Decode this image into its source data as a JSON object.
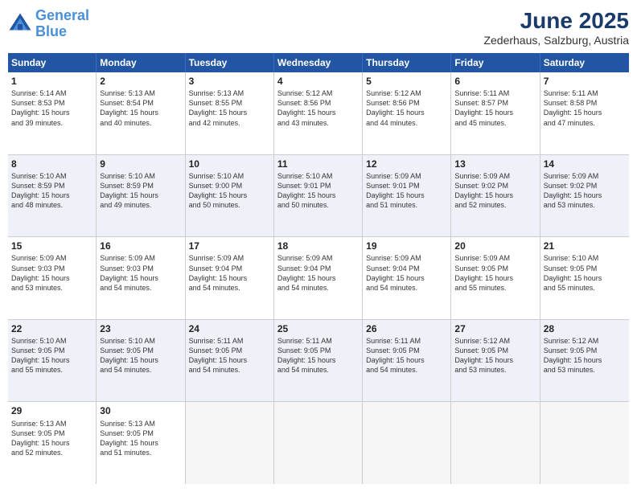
{
  "logo": {
    "text1": "General",
    "text2": "Blue"
  },
  "title": "June 2025",
  "subtitle": "Zederhaus, Salzburg, Austria",
  "header_days": [
    "Sunday",
    "Monday",
    "Tuesday",
    "Wednesday",
    "Thursday",
    "Friday",
    "Saturday"
  ],
  "rows": [
    {
      "cells": [
        {
          "day": "1",
          "lines": [
            "Sunrise: 5:14 AM",
            "Sunset: 8:53 PM",
            "Daylight: 15 hours",
            "and 39 minutes."
          ]
        },
        {
          "day": "2",
          "lines": [
            "Sunrise: 5:13 AM",
            "Sunset: 8:54 PM",
            "Daylight: 15 hours",
            "and 40 minutes."
          ]
        },
        {
          "day": "3",
          "lines": [
            "Sunrise: 5:13 AM",
            "Sunset: 8:55 PM",
            "Daylight: 15 hours",
            "and 42 minutes."
          ]
        },
        {
          "day": "4",
          "lines": [
            "Sunrise: 5:12 AM",
            "Sunset: 8:56 PM",
            "Daylight: 15 hours",
            "and 43 minutes."
          ]
        },
        {
          "day": "5",
          "lines": [
            "Sunrise: 5:12 AM",
            "Sunset: 8:56 PM",
            "Daylight: 15 hours",
            "and 44 minutes."
          ]
        },
        {
          "day": "6",
          "lines": [
            "Sunrise: 5:11 AM",
            "Sunset: 8:57 PM",
            "Daylight: 15 hours",
            "and 45 minutes."
          ]
        },
        {
          "day": "7",
          "lines": [
            "Sunrise: 5:11 AM",
            "Sunset: 8:58 PM",
            "Daylight: 15 hours",
            "and 47 minutes."
          ]
        }
      ]
    },
    {
      "cells": [
        {
          "day": "8",
          "lines": [
            "Sunrise: 5:10 AM",
            "Sunset: 8:59 PM",
            "Daylight: 15 hours",
            "and 48 minutes."
          ]
        },
        {
          "day": "9",
          "lines": [
            "Sunrise: 5:10 AM",
            "Sunset: 8:59 PM",
            "Daylight: 15 hours",
            "and 49 minutes."
          ]
        },
        {
          "day": "10",
          "lines": [
            "Sunrise: 5:10 AM",
            "Sunset: 9:00 PM",
            "Daylight: 15 hours",
            "and 50 minutes."
          ]
        },
        {
          "day": "11",
          "lines": [
            "Sunrise: 5:10 AM",
            "Sunset: 9:01 PM",
            "Daylight: 15 hours",
            "and 50 minutes."
          ]
        },
        {
          "day": "12",
          "lines": [
            "Sunrise: 5:09 AM",
            "Sunset: 9:01 PM",
            "Daylight: 15 hours",
            "and 51 minutes."
          ]
        },
        {
          "day": "13",
          "lines": [
            "Sunrise: 5:09 AM",
            "Sunset: 9:02 PM",
            "Daylight: 15 hours",
            "and 52 minutes."
          ]
        },
        {
          "day": "14",
          "lines": [
            "Sunrise: 5:09 AM",
            "Sunset: 9:02 PM",
            "Daylight: 15 hours",
            "and 53 minutes."
          ]
        }
      ]
    },
    {
      "cells": [
        {
          "day": "15",
          "lines": [
            "Sunrise: 5:09 AM",
            "Sunset: 9:03 PM",
            "Daylight: 15 hours",
            "and 53 minutes."
          ]
        },
        {
          "day": "16",
          "lines": [
            "Sunrise: 5:09 AM",
            "Sunset: 9:03 PM",
            "Daylight: 15 hours",
            "and 54 minutes."
          ]
        },
        {
          "day": "17",
          "lines": [
            "Sunrise: 5:09 AM",
            "Sunset: 9:04 PM",
            "Daylight: 15 hours",
            "and 54 minutes."
          ]
        },
        {
          "day": "18",
          "lines": [
            "Sunrise: 5:09 AM",
            "Sunset: 9:04 PM",
            "Daylight: 15 hours",
            "and 54 minutes."
          ]
        },
        {
          "day": "19",
          "lines": [
            "Sunrise: 5:09 AM",
            "Sunset: 9:04 PM",
            "Daylight: 15 hours",
            "and 54 minutes."
          ]
        },
        {
          "day": "20",
          "lines": [
            "Sunrise: 5:09 AM",
            "Sunset: 9:05 PM",
            "Daylight: 15 hours",
            "and 55 minutes."
          ]
        },
        {
          "day": "21",
          "lines": [
            "Sunrise: 5:10 AM",
            "Sunset: 9:05 PM",
            "Daylight: 15 hours",
            "and 55 minutes."
          ]
        }
      ]
    },
    {
      "cells": [
        {
          "day": "22",
          "lines": [
            "Sunrise: 5:10 AM",
            "Sunset: 9:05 PM",
            "Daylight: 15 hours",
            "and 55 minutes."
          ]
        },
        {
          "day": "23",
          "lines": [
            "Sunrise: 5:10 AM",
            "Sunset: 9:05 PM",
            "Daylight: 15 hours",
            "and 54 minutes."
          ]
        },
        {
          "day": "24",
          "lines": [
            "Sunrise: 5:11 AM",
            "Sunset: 9:05 PM",
            "Daylight: 15 hours",
            "and 54 minutes."
          ]
        },
        {
          "day": "25",
          "lines": [
            "Sunrise: 5:11 AM",
            "Sunset: 9:05 PM",
            "Daylight: 15 hours",
            "and 54 minutes."
          ]
        },
        {
          "day": "26",
          "lines": [
            "Sunrise: 5:11 AM",
            "Sunset: 9:05 PM",
            "Daylight: 15 hours",
            "and 54 minutes."
          ]
        },
        {
          "day": "27",
          "lines": [
            "Sunrise: 5:12 AM",
            "Sunset: 9:05 PM",
            "Daylight: 15 hours",
            "and 53 minutes."
          ]
        },
        {
          "day": "28",
          "lines": [
            "Sunrise: 5:12 AM",
            "Sunset: 9:05 PM",
            "Daylight: 15 hours",
            "and 53 minutes."
          ]
        }
      ]
    },
    {
      "cells": [
        {
          "day": "29",
          "lines": [
            "Sunrise: 5:13 AM",
            "Sunset: 9:05 PM",
            "Daylight: 15 hours",
            "and 52 minutes."
          ]
        },
        {
          "day": "30",
          "lines": [
            "Sunrise: 5:13 AM",
            "Sunset: 9:05 PM",
            "Daylight: 15 hours",
            "and 51 minutes."
          ]
        },
        {
          "day": "",
          "lines": []
        },
        {
          "day": "",
          "lines": []
        },
        {
          "day": "",
          "lines": []
        },
        {
          "day": "",
          "lines": []
        },
        {
          "day": "",
          "lines": []
        }
      ]
    }
  ]
}
